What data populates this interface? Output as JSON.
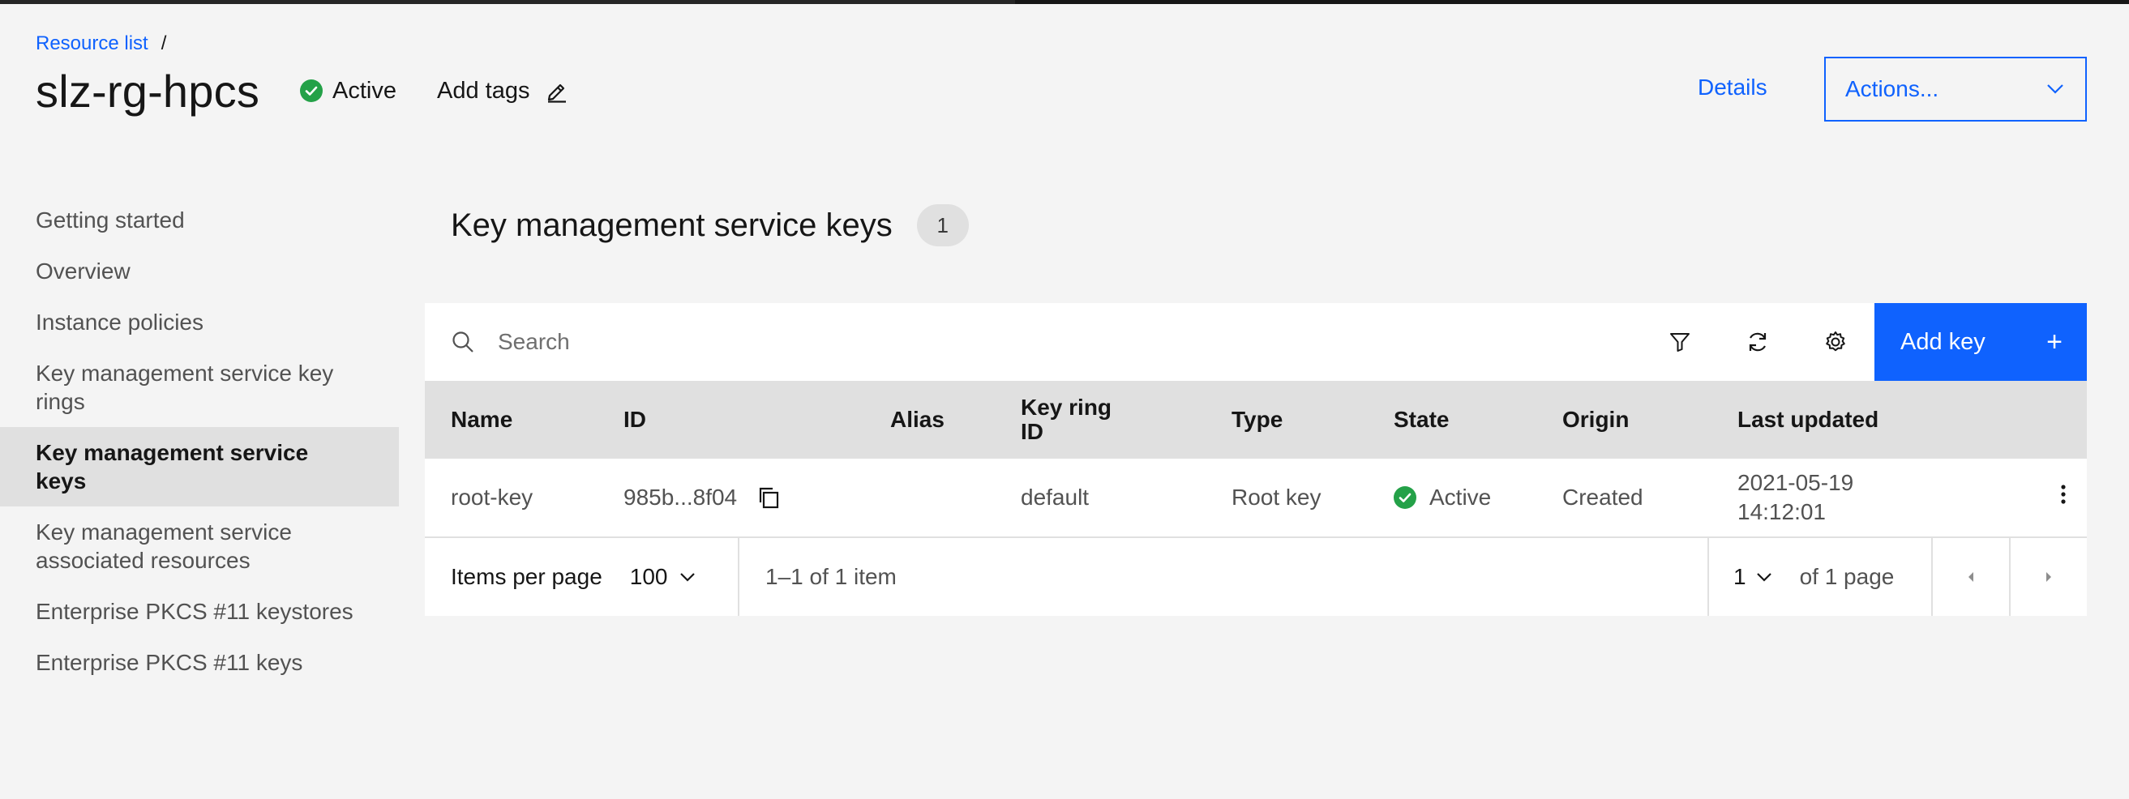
{
  "breadcrumb": {
    "root": "Resource list",
    "separator": "/"
  },
  "header": {
    "title": "slz-rg-hpcs",
    "status": "Active",
    "add_tags": "Add tags",
    "details": "Details",
    "actions": "Actions..."
  },
  "sidebar": {
    "items": [
      {
        "label": "Getting started"
      },
      {
        "label": "Overview"
      },
      {
        "label": "Instance policies"
      },
      {
        "label": "Key management service key rings"
      },
      {
        "label": "Key management service keys"
      },
      {
        "label": "Key management service associated resources"
      },
      {
        "label": "Enterprise PKCS #11 keystores"
      },
      {
        "label": "Enterprise PKCS #11 keys"
      }
    ],
    "active_index": 4
  },
  "section": {
    "title": "Key management service keys",
    "count": "1"
  },
  "toolbar": {
    "search_placeholder": "Search",
    "filter_icon": "filter-icon",
    "refresh_icon": "refresh-icon",
    "settings_icon": "gear-icon",
    "add_key": "Add key",
    "add_key_icon": "+"
  },
  "table": {
    "columns": [
      "Name",
      "ID",
      "Alias",
      "Key ring ID",
      "Type",
      "State",
      "Origin",
      "Last updated"
    ],
    "rows": [
      {
        "name": "root-key",
        "id": "985b...8f04",
        "alias": "",
        "key_ring_id": "default",
        "type": "Root key",
        "state": "Active",
        "origin": "Created",
        "last_updated": "2021-05-19 14:12:01"
      }
    ]
  },
  "pagination": {
    "items_per_page_label": "Items per page",
    "items_per_page_value": "100",
    "range": "1–1 of 1 item",
    "page": "1",
    "page_total": "of 1 page"
  },
  "colors": {
    "accent": "#0f62fe",
    "success": "#24a148",
    "background": "#f4f4f4"
  }
}
